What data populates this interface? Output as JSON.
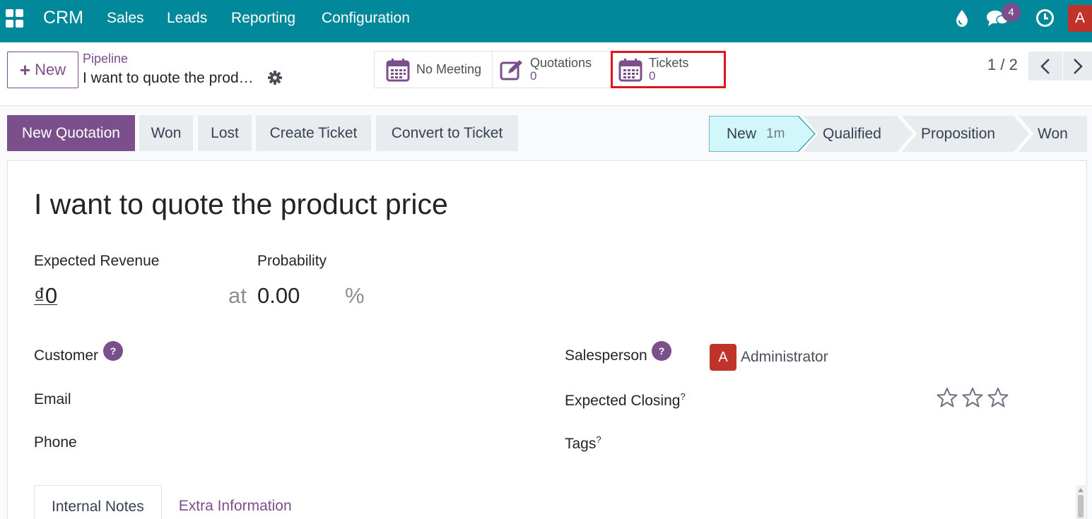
{
  "navbar": {
    "brand": "CRM",
    "menu": [
      "Sales",
      "Leads",
      "Reporting",
      "Configuration"
    ],
    "messages_badge": "4",
    "user_initial": "A",
    "colors": {
      "bar": "#01889a",
      "accent": "#7b4f8c"
    }
  },
  "control_panel": {
    "new_label": "New",
    "breadcrumb": "Pipeline",
    "record_name": "I want to quote the product price",
    "smart_buttons": [
      {
        "label": "No Meeting",
        "value": "",
        "icon": "calendar-icon"
      },
      {
        "label": "Quotations",
        "value": "0",
        "icon": "edit-icon"
      },
      {
        "label": "Tickets",
        "value": "0",
        "icon": "calendar-icon"
      }
    ],
    "pager": "1 / 2"
  },
  "actions": {
    "new_quotation": "New Quotation",
    "won": "Won",
    "lost": "Lost",
    "create_ticket": "Create Ticket",
    "convert_to_ticket": "Convert to Ticket"
  },
  "stages": [
    {
      "name": "New",
      "duration": "1m",
      "active": true
    },
    {
      "name": "Qualified",
      "duration": "",
      "active": false
    },
    {
      "name": "Proposition",
      "duration": "",
      "active": false
    },
    {
      "name": "Won",
      "duration": "",
      "active": false
    }
  ],
  "form": {
    "title": "I want to quote the product price",
    "expected_revenue_label": "Expected Revenue",
    "expected_revenue_value": "₫0",
    "at_label": "at",
    "probability_label": "Probability",
    "probability_value": "0.00",
    "percent_sign": "%",
    "customer_label": "Customer",
    "email_label": "Email",
    "phone_label": "Phone",
    "salesperson_label": "Salesperson",
    "salesperson_initial": "A",
    "salesperson_name": "Administrator",
    "expected_closing_label": "Expected Closing",
    "tags_label": "Tags",
    "help_mark": "?",
    "superscript_mark": "?",
    "priority_stars": 0,
    "priority_max": 3
  },
  "tabs": [
    "Internal Notes",
    "Extra Information"
  ]
}
